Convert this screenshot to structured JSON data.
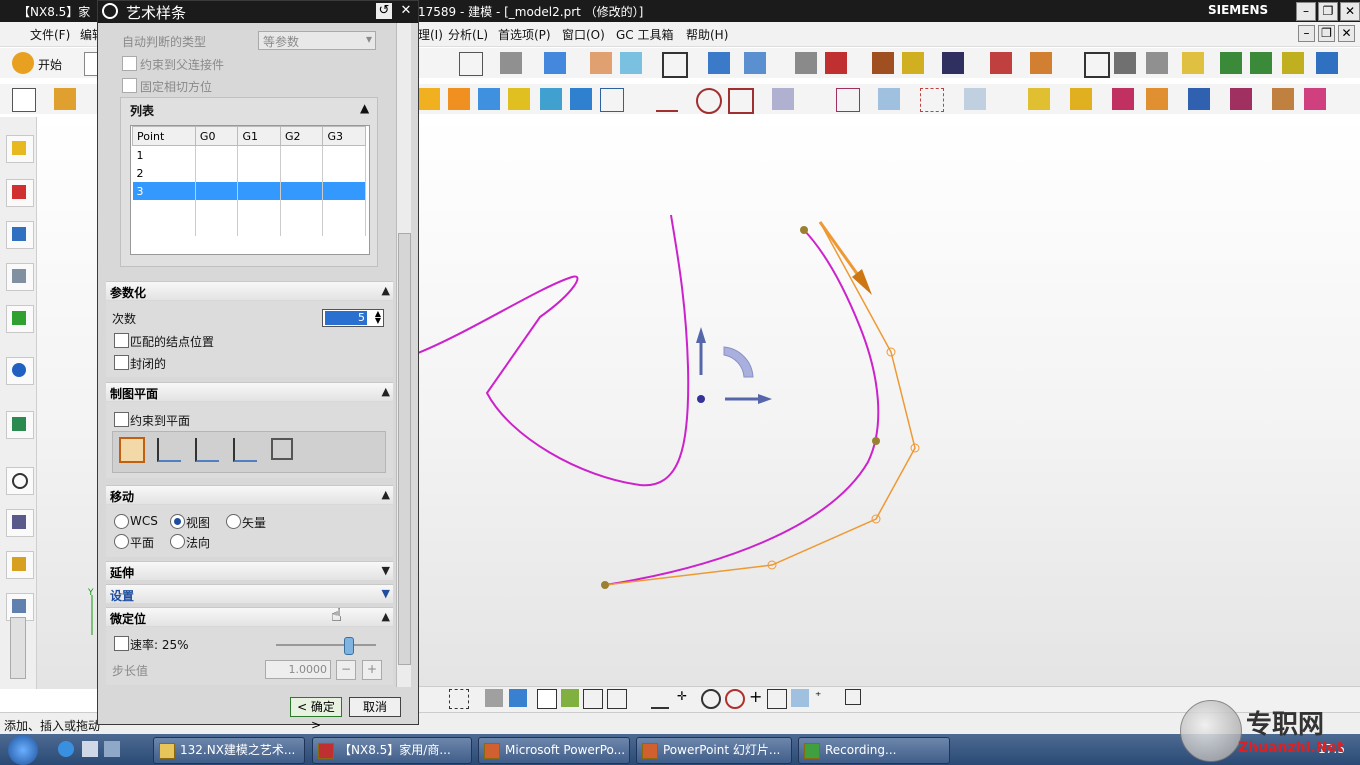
{
  "window": {
    "app_tag": "【NX8.5】家",
    "title": "17589 - 建模 - [_model2.prt （修改的）]",
    "brand": "SIEMENS"
  },
  "menu": [
    "文件(F)",
    "编辑",
    "理(I)",
    "分析(L)",
    "首选项(P)",
    "窗口(O)",
    "GC 工具箱",
    "帮助(H)"
  ],
  "toolbar": {
    "start_label": "开始"
  },
  "dialog": {
    "title": "艺术样条",
    "auto_type_label": "自动判断的类型",
    "auto_type_value": "等参数",
    "opt_constraint": "约束到父连接件",
    "opt_fixed_tangent": "固定相切方位",
    "list_section": "列表",
    "table_headers": [
      "Point",
      "G0",
      "G1",
      "G2",
      "G3"
    ],
    "table_rows": [
      {
        "point": "1",
        "selected": false
      },
      {
        "point": "2",
        "selected": false
      },
      {
        "point": "3",
        "selected": true
      }
    ],
    "param_section": "参数化",
    "degree_label": "次数",
    "degree_value": "5",
    "match_knots": "匹配的结点位置",
    "closed": "封闭的",
    "plane_section": "制图平面",
    "constrain_plane": "约束到平面",
    "move_section": "移动",
    "move_options": [
      "WCS",
      "视图",
      "矢量",
      "平面",
      "法向"
    ],
    "move_selected": "视图",
    "extend_section": "延伸",
    "settings_section": "设置",
    "fine_section": "微定位",
    "rate_label": "速率: 25%",
    "rate_value": 25,
    "step_label": "步长值",
    "step_value": "1.0000",
    "ok_label": "< 确定 >",
    "cancel_label": "取消"
  },
  "status": {
    "hint": "添加、插入或拖动"
  },
  "taskbar": {
    "items": [
      "132.NX建模之艺术...",
      "【NX8.5】家用/商...",
      "Microsoft PowerPo...",
      "PowerPoint 幻灯片...",
      "Recording..."
    ],
    "clock": "17:5"
  },
  "watermark": {
    "cn": "专职网",
    "en": "Zhuanzhi.Net"
  },
  "colors": {
    "curve": "#cc22cc",
    "control_polygon": "#ee9933",
    "selection": "#3399ff",
    "title_bar": "#1b1b1b"
  }
}
